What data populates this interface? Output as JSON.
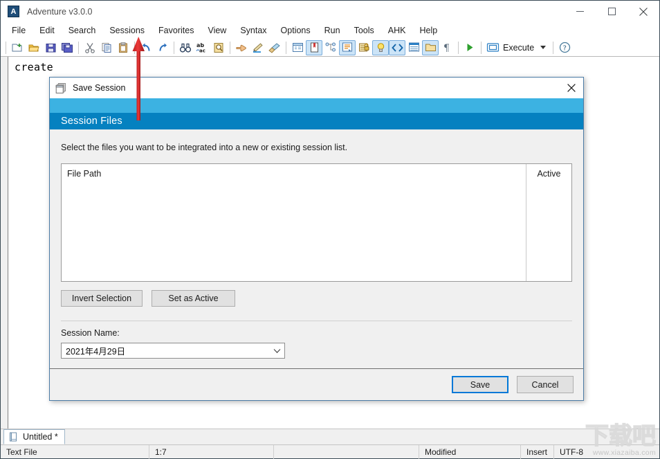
{
  "window": {
    "title": "Adventure v3.0.0",
    "app_icon_letter": "A",
    "controls": {
      "minimize": "minimize-icon",
      "maximize": "maximize-icon",
      "close": "close-icon"
    }
  },
  "menu": {
    "items": [
      {
        "label": "File"
      },
      {
        "label": "Edit"
      },
      {
        "label": "Search"
      },
      {
        "label": "Sessions"
      },
      {
        "label": "Favorites"
      },
      {
        "label": "View"
      },
      {
        "label": "Syntax"
      },
      {
        "label": "Options"
      },
      {
        "label": "Run"
      },
      {
        "label": "Tools"
      },
      {
        "label": "AHK"
      },
      {
        "label": "Help"
      }
    ]
  },
  "toolbar": {
    "execute_label": "Execute",
    "buttons": [
      {
        "name": "new-file-icon"
      },
      {
        "name": "open-folder-icon"
      },
      {
        "name": "save-icon"
      },
      {
        "name": "save-all-icon"
      },
      {
        "name": "cut-icon"
      },
      {
        "name": "copy-icon"
      },
      {
        "name": "paste-icon"
      },
      {
        "name": "undo-icon"
      },
      {
        "name": "redo-icon"
      },
      {
        "name": "find-icon"
      },
      {
        "name": "replace-icon"
      },
      {
        "name": "find-in-files-icon"
      },
      {
        "name": "goto-icon"
      },
      {
        "name": "pencil-icon"
      },
      {
        "name": "clear-icon"
      },
      {
        "name": "window-list-icon"
      },
      {
        "name": "bookmark-icon"
      },
      {
        "name": "node-tree-icon"
      },
      {
        "name": "properties-icon"
      },
      {
        "name": "lock-icon"
      },
      {
        "name": "lightbulb-icon"
      },
      {
        "name": "code-icon"
      },
      {
        "name": "list-icon"
      },
      {
        "name": "folder-icon"
      },
      {
        "name": "pilcrow-icon"
      },
      {
        "name": "run-icon"
      }
    ]
  },
  "editor": {
    "content": "create"
  },
  "tabs": {
    "items": [
      {
        "label": "Untitled  *",
        "icon": "document-icon"
      }
    ]
  },
  "status_bar": {
    "file_type": "Text File",
    "caret": "1:7",
    "blank": "",
    "modified": "Modified",
    "insert_mode": "Insert",
    "encoding": "UTF-8"
  },
  "dialog": {
    "title": "Save Session",
    "title_icon": "session-windows-icon",
    "close_icon": "close-icon",
    "banner_title": "Session Files",
    "instruction": "Select the files you want to be integrated into a new or existing session list.",
    "list": {
      "columns": [
        "File Path",
        "Active"
      ],
      "rows": []
    },
    "selection_buttons": [
      {
        "label": "Invert Selection"
      },
      {
        "label": "Set as Active"
      }
    ],
    "session_name_label": "Session Name:",
    "session_name_value": "2021年4月29日",
    "session_name_dropdown_icon": "chevron-down-icon",
    "footer_buttons": [
      {
        "label": "Save",
        "default": true
      },
      {
        "label": "Cancel",
        "default": false
      }
    ]
  },
  "annotation": {
    "arrow_color": "#e03030",
    "arrow_direction": "up"
  },
  "watermark": {
    "logo_text": "下载吧",
    "url": "www.xiazaiba.com"
  },
  "colors": {
    "banner_light": "#3cb2e2",
    "banner_dark": "#0581c0",
    "dialog_border": "#4b7ba5",
    "accent_focus": "#0078d7",
    "dialog_bg": "#f0f0f0"
  }
}
